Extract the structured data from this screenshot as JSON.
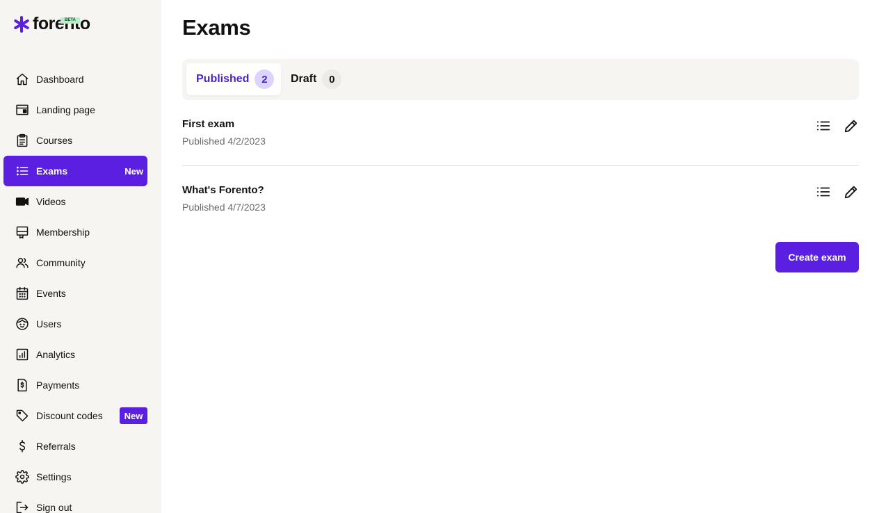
{
  "brand": {
    "name": "forento",
    "beta_label": "BETA",
    "accent": "#5a1fe0",
    "beta_color": "#b7efc9"
  },
  "nav": [
    {
      "label": "Dashboard",
      "icon": "home-icon"
    },
    {
      "label": "Landing page",
      "icon": "layout-icon"
    },
    {
      "label": "Courses",
      "icon": "clipboard-icon"
    },
    {
      "label": "Exams",
      "icon": "list-icon",
      "active": true,
      "badge": "New"
    },
    {
      "label": "Videos",
      "icon": "video-camera-icon"
    },
    {
      "label": "Membership",
      "icon": "membership-card-icon"
    },
    {
      "label": "Community",
      "icon": "users-group-icon"
    },
    {
      "label": "Events",
      "icon": "calendar-icon"
    },
    {
      "label": "Users",
      "icon": "user-face-icon"
    },
    {
      "label": "Analytics",
      "icon": "bar-chart-icon"
    },
    {
      "label": "Payments",
      "icon": "invoice-dollar-icon"
    },
    {
      "label": "Discount codes",
      "icon": "tag-icon",
      "badge": "New"
    },
    {
      "label": "Referrals",
      "icon": "dollar-icon"
    },
    {
      "label": "Settings",
      "icon": "gear-icon"
    },
    {
      "label": "Sign out",
      "icon": "sign-out-icon"
    }
  ],
  "page": {
    "title": "Exams"
  },
  "tabs": [
    {
      "label": "Published",
      "count": "2",
      "active": true
    },
    {
      "label": "Draft",
      "count": "0",
      "active": false
    }
  ],
  "exams": [
    {
      "title": "First exam",
      "status": "Published 4/2/2023"
    },
    {
      "title": "What's Forento?",
      "status": "Published 4/7/2023"
    }
  ],
  "actions": {
    "create_label": "Create exam"
  }
}
